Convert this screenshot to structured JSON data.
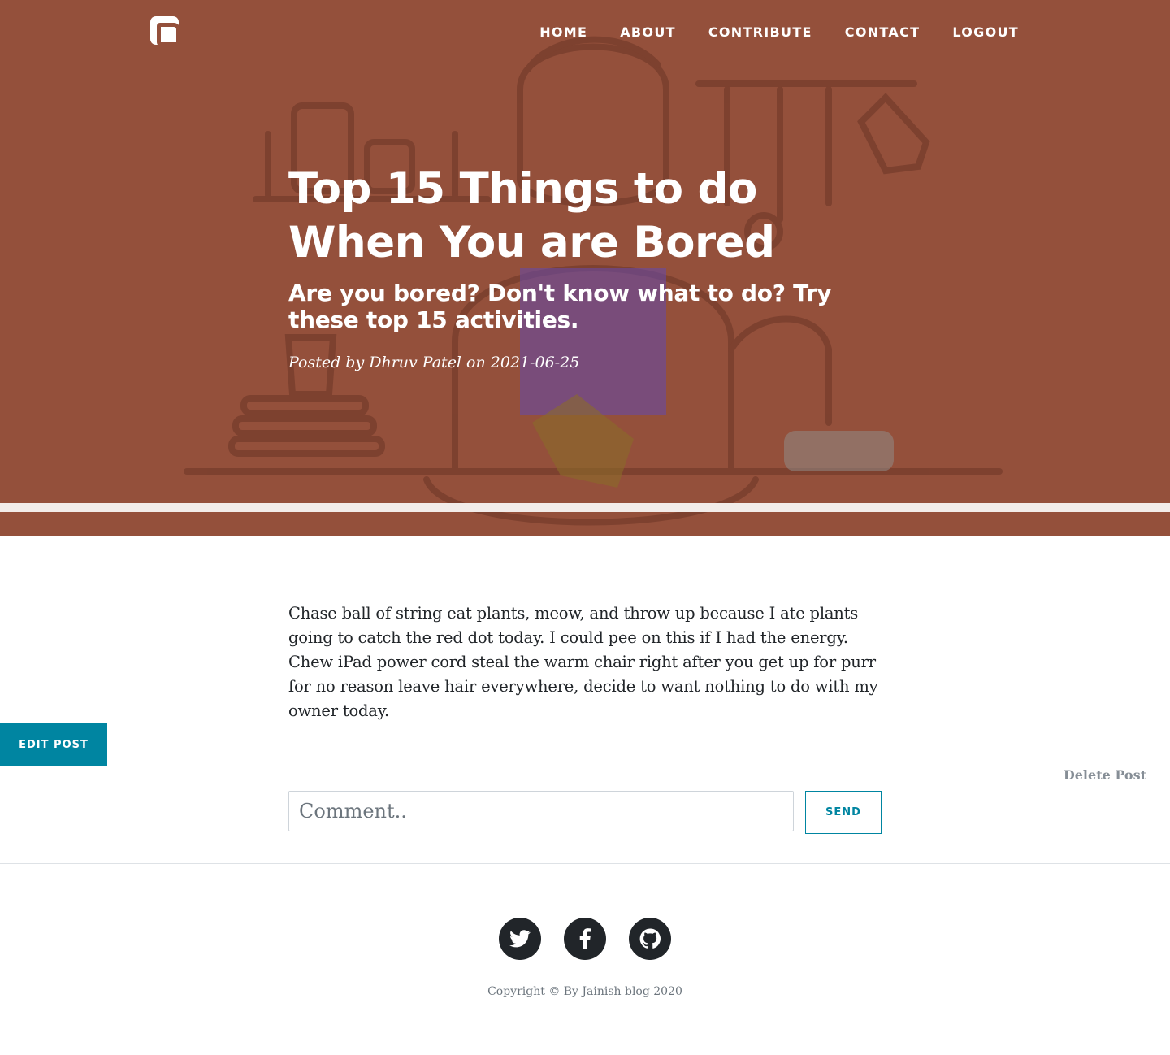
{
  "nav": {
    "items": [
      {
        "label": "HOME"
      },
      {
        "label": "ABOUT"
      },
      {
        "label": "CONTRIBUTE"
      },
      {
        "label": "CONTACT"
      },
      {
        "label": "LOGOUT"
      }
    ]
  },
  "post": {
    "title": "Top 15 Things to do When You are Bored",
    "subtitle": "Are you bored? Don't know what to do? Try these top 15 activities.",
    "meta_prefix": "Posted by ",
    "author": "Dhruv Patel",
    "meta_on": " on ",
    "date": "2021-06-25",
    "body": "Chase ball of string eat plants, meow, and throw up because I ate plants going to catch the red dot today. I could pee on this if I had the energy. Chew iPad power cord steal the warm chair right after you get up for purr for no reason leave hair everywhere, decide to want nothing to do with my owner today."
  },
  "actions": {
    "edit_label": "EDIT POST",
    "delete_label": "Delete Post"
  },
  "comment": {
    "placeholder": "Comment..",
    "send_label": "SEND"
  },
  "footer": {
    "socials": [
      {
        "icon": "twitter-icon"
      },
      {
        "icon": "facebook-icon"
      },
      {
        "icon": "github-icon"
      }
    ],
    "copyright": "Copyright © By Jainish blog 2020"
  },
  "colors": {
    "header_overlay": "#94503b",
    "accent": "#0085a1",
    "footer_icon": "#212529"
  }
}
